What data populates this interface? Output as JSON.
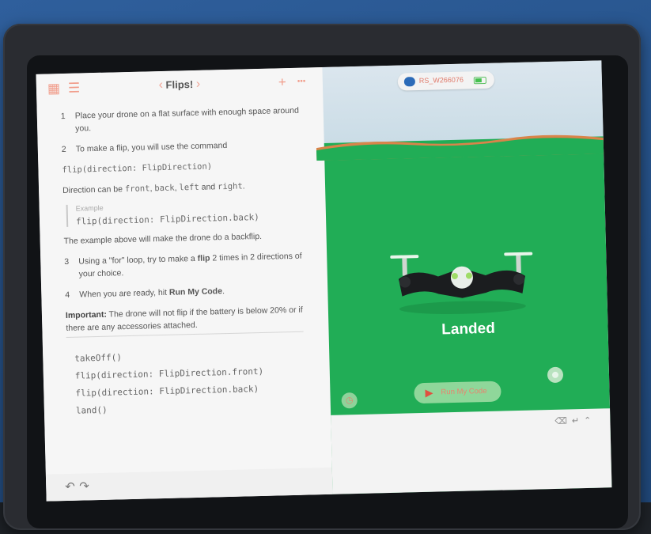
{
  "left_panel": {
    "title": "Flips!",
    "steps": {
      "s1_num": "1",
      "s1_text": "Place your drone on a flat surface with enough space around you.",
      "s2_num": "2",
      "s2_text": "To make a flip, you will use the command",
      "s2_code": "flip(direction: FlipDirection)",
      "direction_prefix": "Direction can be ",
      "dir_front": "front",
      "dir_back": "back",
      "dir_left": "left",
      "dir_and": " and ",
      "dir_right": "right",
      "example_label": "Example",
      "example_code": "flip(direction: FlipDirection.back)",
      "example_note": "The example above will make the drone do a backflip.",
      "s3_num": "3",
      "s3_pre": "Using a \"for\" loop, try to make a ",
      "s3_bold": "flip",
      "s3_post": " 2 times in 2 directions of your choice.",
      "s4_num": "4",
      "s4_pre": "When you are ready, hit ",
      "s4_bold": "Run My Code",
      "s4_post": ".",
      "important_label": "Important:",
      "important_text": " The drone will not flip if the battery is below 20% or if there are any accessories attached."
    },
    "code_lines": [
      "takeOff()",
      "flip(direction: FlipDirection.front)",
      "flip(direction: FlipDirection.back)",
      "land()"
    ]
  },
  "right_panel": {
    "drone_name": "RS_W266076",
    "status": "Landed",
    "run_button": "Run My Code"
  },
  "icons": {
    "grid": "grid-icon",
    "list": "list-icon",
    "back": "chevron-left-icon",
    "forward": "chevron-right-icon",
    "add": "plus-icon",
    "more": "more-icon",
    "undo": "undo-icon",
    "redo": "redo-icon",
    "drone": "drone-icon",
    "battery": "battery-icon",
    "play": "play-icon",
    "timer": "timer-icon",
    "camera": "camera-icon"
  },
  "colors": {
    "accent": "#f0927f",
    "ground": "#21ad56",
    "sky": "#d4e3ec",
    "run_button": "#8fd79a",
    "status_text": "#ffffff"
  }
}
